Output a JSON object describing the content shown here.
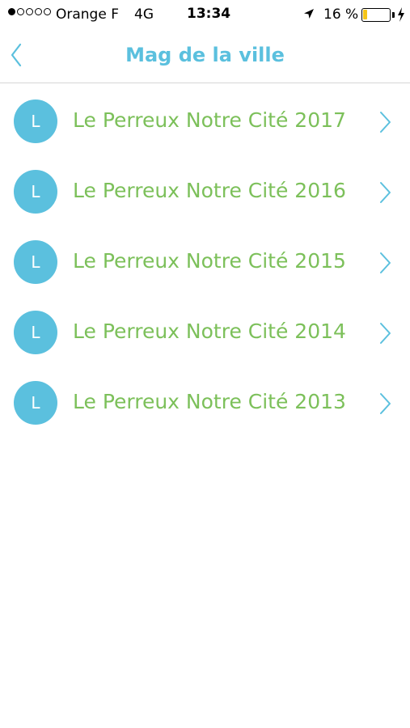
{
  "status_bar": {
    "carrier": "Orange F",
    "network": "4G",
    "time": "13:34",
    "battery_percent": "16 %",
    "battery_level": 0.16,
    "battery_color": "#f5c518",
    "signal_bars_filled": 1,
    "signal_bars_total": 5
  },
  "nav": {
    "title": "Mag de la ville",
    "back_icon": "chevron-left-icon"
  },
  "colors": {
    "accent": "#5bc0de",
    "item_text": "#7cc05a"
  },
  "items": [
    {
      "avatar_letter": "L",
      "label": "Le Perreux Notre Cité 2017"
    },
    {
      "avatar_letter": "L",
      "label": "Le Perreux Notre Cité 2016"
    },
    {
      "avatar_letter": "L",
      "label": "Le Perreux Notre Cité 2015"
    },
    {
      "avatar_letter": "L",
      "label": "Le Perreux Notre Cité 2014"
    },
    {
      "avatar_letter": "L",
      "label": "Le Perreux Notre Cité 2013"
    }
  ]
}
